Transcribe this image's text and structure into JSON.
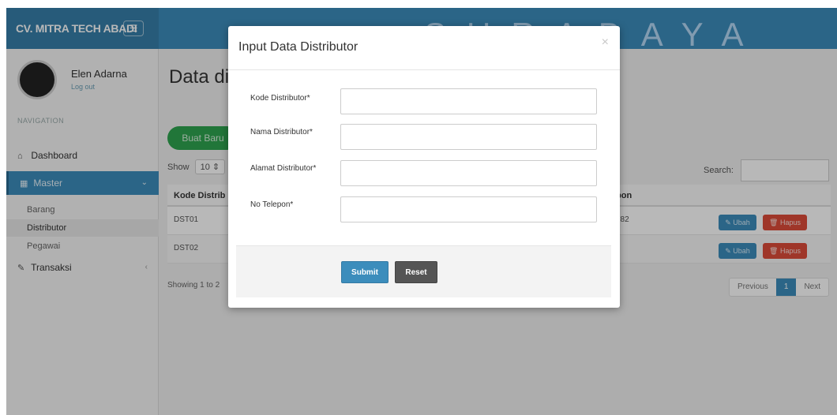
{
  "app": {
    "brand": "CV. MITRA TECH ABADI",
    "toggle_icon": "hamburger-icon"
  },
  "user": {
    "name": "Elen Adarna",
    "logout": "Log out"
  },
  "sidebar": {
    "header": "NAVIGATION",
    "items": [
      {
        "label": "Dashboard",
        "icon": "home-icon"
      },
      {
        "label": "Master",
        "icon": "grid-icon",
        "active": true
      },
      {
        "label": "Transaksi",
        "icon": "edit-icon"
      }
    ],
    "sub_items": [
      "Barang",
      "Distributor",
      "Pegawai"
    ]
  },
  "main": {
    "title": "Data di",
    "new_button": "Buat Baru",
    "show_label": "Show",
    "show_value": "10",
    "search_label": "Search:",
    "columns": [
      "Kode Distrib",
      "pon",
      ""
    ],
    "rows": [
      {
        "kode": "DST01",
        "telp": "782"
      },
      {
        "kode": "DST02",
        "telp": ""
      }
    ],
    "edit_label": "Ubah",
    "delete_label": "Hapus",
    "info": "Showing 1 to 2",
    "pager": {
      "previous": "Previous",
      "current": "1",
      "next": "Next"
    }
  },
  "watermark": "SURABAYA",
  "modal": {
    "title": "Input Data Distributor",
    "close": "×",
    "fields": [
      {
        "label": "Kode Distributor*",
        "value": ""
      },
      {
        "label": "Nama Distributor*",
        "value": ""
      },
      {
        "label": "Alamat Distributor*",
        "value": ""
      },
      {
        "label": "No Telepon*",
        "value": ""
      }
    ],
    "submit": "Submit",
    "reset": "Reset"
  },
  "colors": {
    "primary": "#3c8dbc",
    "success": "#2ea44f",
    "danger": "#dd4b39",
    "dark": "#555555"
  }
}
